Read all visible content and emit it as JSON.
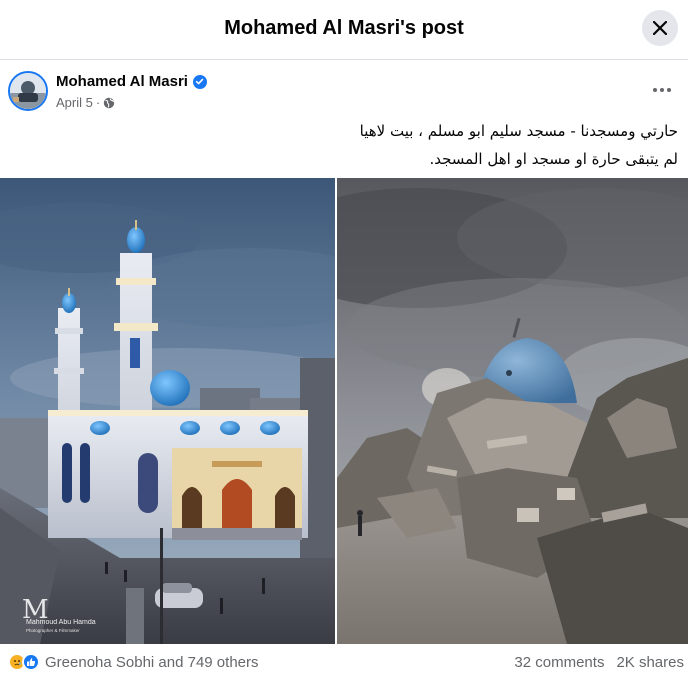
{
  "dialog": {
    "title": "Mohamed Al Masri's post"
  },
  "post": {
    "author": "Mohamed Al Masri",
    "date": "April 5",
    "date_separator": "·",
    "audience_icon": "globe-icon",
    "text_line1": "حارتي ومسجدنا - مسجد سليم ابو مسلم ، بيت لاهيا",
    "text_line2": "لم يتبقى حارة او مسجد او اهل المسجد."
  },
  "photos": {
    "left_watermark_name": "Mahmoud Abu Hamda",
    "left_watermark_sub": "Photographer & Filmmaker",
    "left_watermark_logo": "M"
  },
  "engagement": {
    "reactions_text": "Greenoha Sobhi and 749 others",
    "comments": "32 comments",
    "shares": "2K shares"
  },
  "colors": {
    "accent": "#1877f2",
    "secondary_text": "#65676b",
    "divider": "#dadde1"
  }
}
